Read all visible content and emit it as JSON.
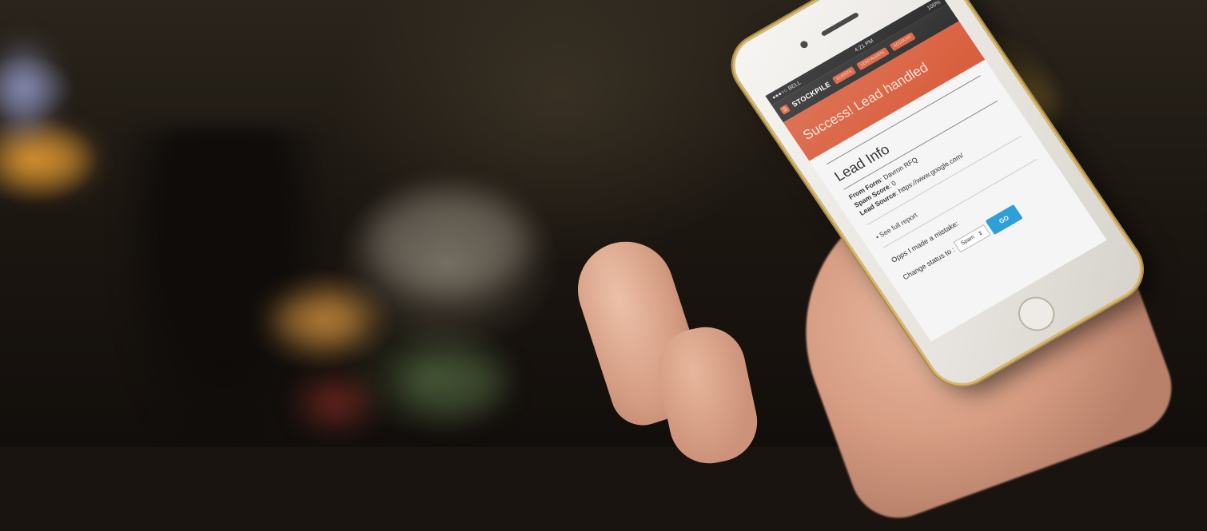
{
  "statusbar": {
    "carrier": "●●●○○ BELL",
    "time": "4:21 PM",
    "battery": "100%"
  },
  "nav": {
    "logo_text": "STOCKPILE",
    "pills": [
      "CLIENTS",
      "LEAD ALERTS",
      "ACCOUNT"
    ]
  },
  "banner": {
    "text": "Success! Lead handled"
  },
  "lead_info": {
    "title": "Lead Info",
    "from_form_label": "From Form",
    "from_form_value": ": Davron RFQ",
    "spam_score_label": "Spam Score",
    "spam_score_value": ": 0",
    "lead_source_label": "Lead Source",
    "lead_source_value": ": https://www.google.com/",
    "full_report_link": "• See full report"
  },
  "status_change": {
    "mistake_text": "Opps I made a mistake:",
    "change_label": "Change status to :",
    "selected_option": "Spam",
    "go_label": "GO"
  },
  "colors": {
    "brand_orange": "#d9603f",
    "go_blue": "#2f9fd8",
    "phone_gold": "#d8b86e"
  }
}
